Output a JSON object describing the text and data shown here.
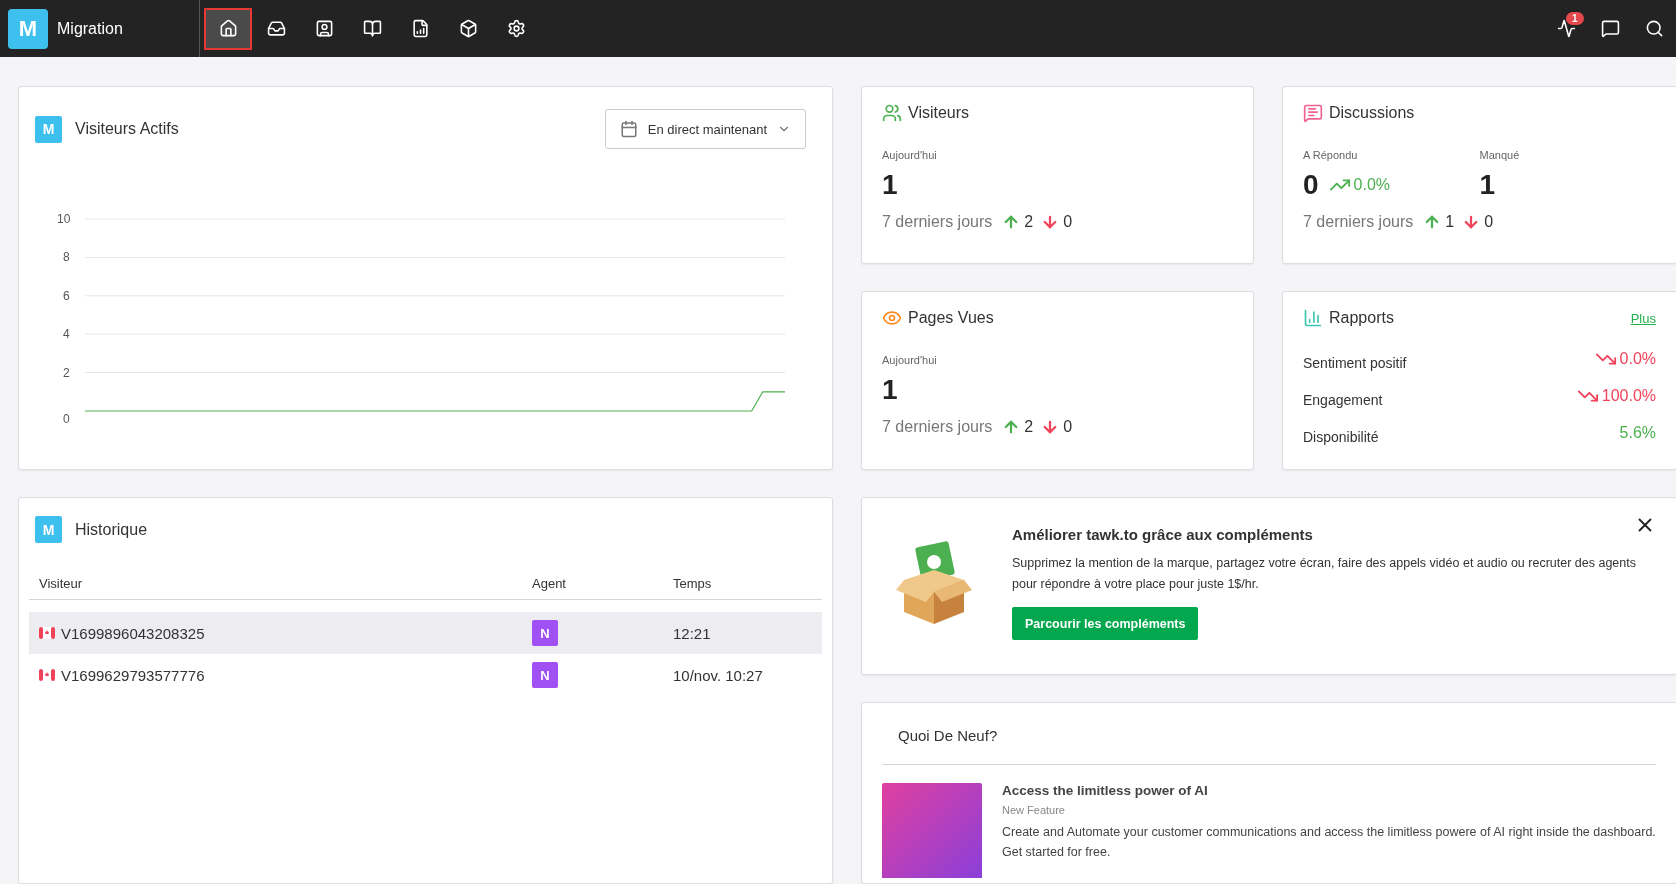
{
  "brand": {
    "letter": "M",
    "name": "Migration"
  },
  "nav": [
    {
      "kind": "home",
      "selected": true
    },
    {
      "kind": "inbox",
      "selected": false
    },
    {
      "kind": "contacts",
      "selected": false
    },
    {
      "kind": "knowledge",
      "selected": false
    },
    {
      "kind": "reports",
      "selected": false
    },
    {
      "kind": "addons",
      "selected": false
    },
    {
      "kind": "settings",
      "selected": false
    }
  ],
  "top_actions": [
    {
      "kind": "activity",
      "badge": "1"
    },
    {
      "kind": "chat"
    },
    {
      "kind": "search"
    }
  ],
  "active_visitors": {
    "letter": "M",
    "title": "Visiteurs Actifs",
    "dropdown": "En direct maintenant",
    "chart_data": {
      "type": "line",
      "grid": true,
      "ylim": [
        0,
        10
      ],
      "yticks": [
        0,
        2,
        4,
        6,
        8,
        10
      ],
      "series": [
        {
          "color": "#4caf50",
          "values": [
            0,
            0,
            0,
            0,
            0,
            0,
            0,
            0,
            0,
            0,
            0,
            0,
            0,
            0,
            0,
            0,
            0,
            0,
            0,
            0,
            0,
            0,
            0,
            0,
            0,
            0,
            0,
            0,
            0,
            0,
            0,
            0,
            0,
            0,
            0,
            0,
            0,
            0,
            0,
            0,
            0,
            0,
            0,
            0,
            0,
            0,
            0,
            0,
            0,
            0,
            0,
            0,
            0,
            0,
            0,
            0,
            0,
            0,
            0,
            0,
            0,
            1,
            1,
            1
          ]
        }
      ]
    }
  },
  "stats": [
    {
      "kind": "visitors",
      "title": "Visiteurs",
      "columns": [
        {
          "label": "Aujourd'hui",
          "value": "1"
        }
      ],
      "period": "7 derniers jours",
      "up": "2",
      "down": "0"
    },
    {
      "kind": "chats",
      "title": "Discussions",
      "columns": [
        {
          "label": "A Répondu",
          "value": "0",
          "trend": "0.0%"
        },
        {
          "label": "Manqué",
          "value": "1"
        }
      ],
      "period": "7 derniers jours",
      "up": "1",
      "down": "0"
    },
    {
      "kind": "pageviews",
      "title": "Pages Vues",
      "columns": [
        {
          "label": "Aujourd'hui",
          "value": "1"
        }
      ],
      "period": "7 derniers jours",
      "up": "2",
      "down": "0"
    }
  ],
  "reports": {
    "title": "Rapports",
    "link": "Plus",
    "rows": [
      {
        "label": "Sentiment positif",
        "value": "0.0%",
        "kind": "down"
      },
      {
        "label": "Engagement",
        "value": "100.0%",
        "kind": "down"
      },
      {
        "label": "Disponibilité",
        "value": "5.6%",
        "kind": "neutral"
      }
    ]
  },
  "history": {
    "letter": "M",
    "title": "Historique",
    "columns": [
      "Visiteur",
      "Agent",
      "Temps"
    ],
    "rows": [
      {
        "visitor": "V1699896043208325",
        "agent": "N",
        "time": "12:21",
        "selected": true
      },
      {
        "visitor": "V1699629793577776",
        "agent": "N",
        "time": "10/nov. 10:27",
        "selected": false
      }
    ]
  },
  "promo": {
    "title": "Améliorer tawk.to grâce aux compléments",
    "text": "Supprimez la mention de la marque, partagez votre écran, faire des appels vidéo et audio ou recruter des agents pour répondre à votre place pour juste 1$/hr.",
    "button": "Parcourir les compléments"
  },
  "news": {
    "title": "Quoi De Neuf?",
    "items": [
      {
        "title": "Access the limitless power of AI",
        "tag": "New Feature",
        "text": "Create and Automate your customer communications and access the limitless powere of AI right inside the dashboard. Get started for free."
      }
    ]
  }
}
